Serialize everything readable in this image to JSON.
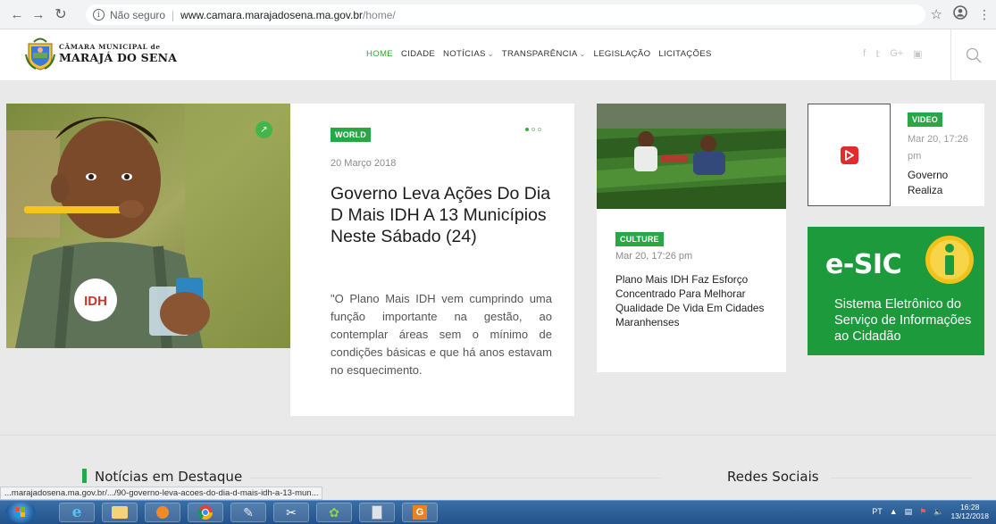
{
  "browser": {
    "security_label": "Não seguro",
    "host": "www.camara.marajadosena.ma.gov.br",
    "path": "/home/"
  },
  "site": {
    "logo_line1": "CÂMARA MUNICIPAL de",
    "logo_line2": "MARAJÁ DO SENA",
    "nav": [
      {
        "label": "HOME",
        "active": true,
        "dropdown": false
      },
      {
        "label": "CIDADE",
        "dropdown": false
      },
      {
        "label": "NOTÍCIAS",
        "dropdown": true
      },
      {
        "label": "TRANSPARÊNCIA",
        "dropdown": true
      },
      {
        "label": "LEGISLAÇÃO",
        "dropdown": false
      },
      {
        "label": "LICITAÇÕES",
        "dropdown": false
      }
    ],
    "social": [
      "f",
      "𝕥",
      "G+",
      "▣"
    ]
  },
  "main_post": {
    "tag": "WORLD",
    "date": "20 Março 2018",
    "title": "Governo Leva Ações Do Dia D Mais IDH A 13 Municípios Neste Sábado (24)",
    "excerpt": "\"O Plano Mais IDH vem cumprindo uma função importante na gestão, ao contemplar áreas sem o mínimo de condições básicas e que há anos estavam no esquecimento."
  },
  "mid_post": {
    "tag": "CULTURE",
    "date": "Mar 20, 17:26 pm",
    "title": "Plano Mais IDH Faz Esforço Concentrado Para Melhorar Qualidade De Vida Em Cidades Maranhenses"
  },
  "video_post": {
    "tag": "VIDEO",
    "date": "Mar 20, 17:26 pm",
    "title": "Governo Realiza"
  },
  "esic_banner": {
    "title": "e-SIC",
    "line1": "Sistema Eletrônico do",
    "line2": "Serviço de Informações",
    "line3": "ao Cidadão"
  },
  "sections": {
    "featured": "Notícias em Destaque",
    "social": "Redes Sociais"
  },
  "status_url": "...marajadosena.ma.gov.br/.../90-governo-leva-acoes-do-dia-d-mais-idh-a-13-mun...",
  "taskbar": {
    "lang": "PT",
    "time": "16:28",
    "date": "13/12/2018"
  },
  "colors": {
    "accent": "#28a745",
    "esic": "#1d9a3c",
    "taskbar": "#2b5d96"
  }
}
